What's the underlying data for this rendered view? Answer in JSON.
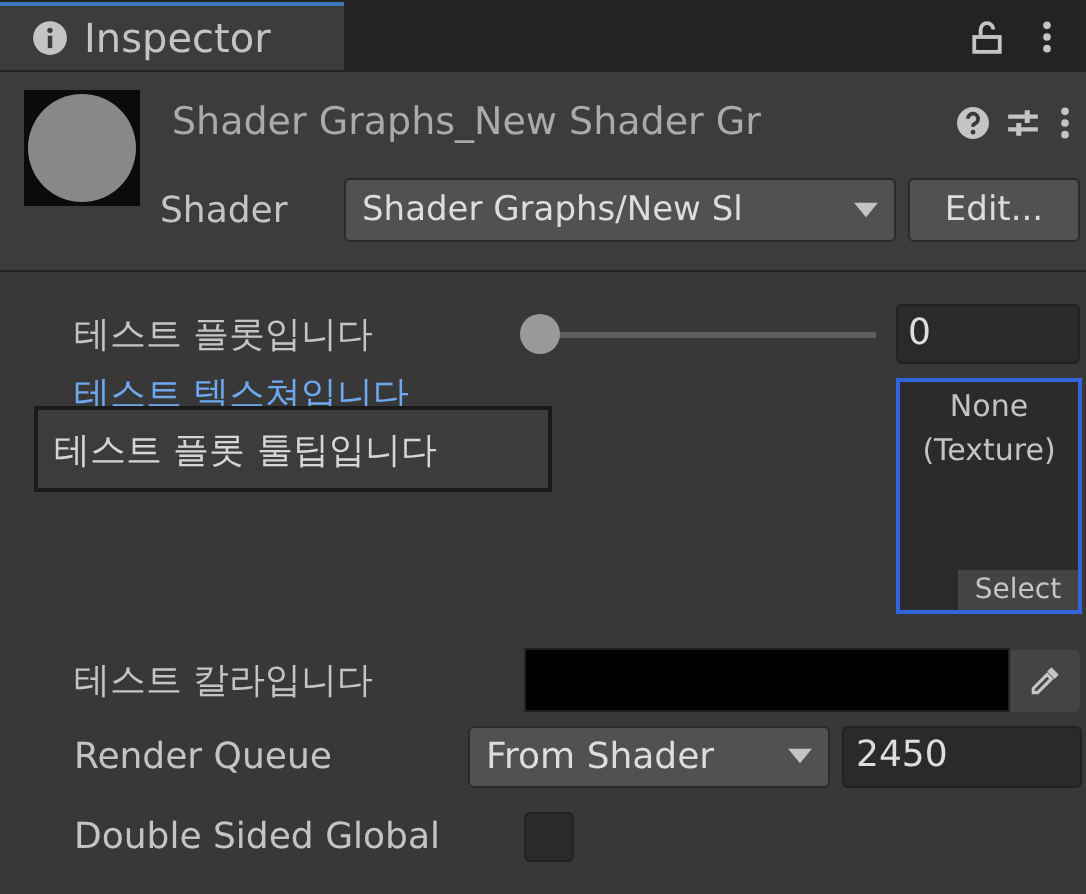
{
  "tab": {
    "title": "Inspector",
    "selected": true
  },
  "header": {
    "title": "Shader Graphs_New Shader Gr",
    "shader_label": "Shader",
    "shader_value": "Shader Graphs/New Sl",
    "edit_button": "Edit..."
  },
  "properties": [
    {
      "kind": "slider",
      "label": "테스트 플롯입니다",
      "level": 0,
      "value": "0"
    },
    {
      "kind": "texture",
      "label": "테스트 텍스쳐입니다",
      "slot_text": "None\n(Texture)",
      "select_button": "Select",
      "selected": true
    },
    {
      "kind": "color",
      "label": "테스트 칼라입니다",
      "color": "#000000"
    },
    {
      "kind": "queue",
      "label": "Render Queue",
      "dropdown": "From Shader",
      "value": "2450"
    },
    {
      "kind": "checkbox",
      "label": "Double Sided Global",
      "checked": false
    }
  ],
  "tooltip": {
    "text": "테스트 플롯 툴팁입니다"
  }
}
